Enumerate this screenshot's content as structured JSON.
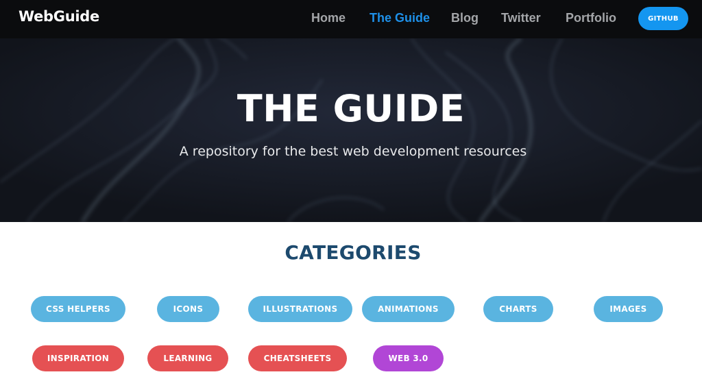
{
  "nav": {
    "brand": "WebGuide",
    "links": [
      "Home",
      "The Guide",
      "Blog",
      "Twitter",
      "Portfolio"
    ],
    "active_link": "The Guide",
    "github_button": "GITHUB"
  },
  "hero": {
    "title": "THE GUIDE",
    "subtitle": "A repository for the best web development resources"
  },
  "categories": {
    "heading": "CATEGORIES",
    "items": [
      {
        "label": "CSS HELPERS",
        "color": "#5ab4e0"
      },
      {
        "label": "ICONS",
        "color": "#5ab4e0"
      },
      {
        "label": "ILLUSTRATIONS",
        "color": "#5ab4e0"
      },
      {
        "label": "ANIMATIONS",
        "color": "#5ab4e0"
      },
      {
        "label": "CHARTS",
        "color": "#5ab4e0"
      },
      {
        "label": "IMAGES",
        "color": "#5ab4e0"
      },
      {
        "label": "INSPIRATION",
        "color": "#e55153"
      },
      {
        "label": "LEARNING",
        "color": "#e55153"
      },
      {
        "label": "CHEATSHEETS",
        "color": "#e55153"
      },
      {
        "label": "WEB 3.0",
        "color": "#b146d6"
      }
    ]
  },
  "colors": {
    "nav_background": "#0b0c0e",
    "accent": "#1e90e8",
    "heading": "#1d4a6e"
  }
}
